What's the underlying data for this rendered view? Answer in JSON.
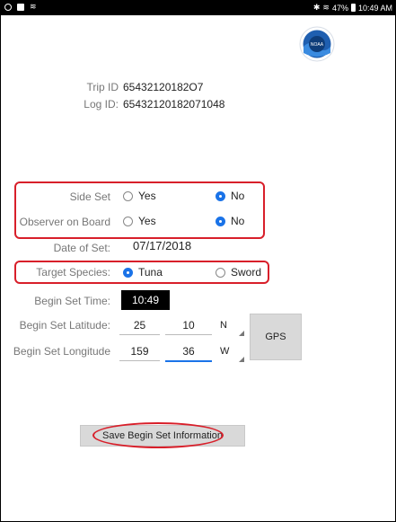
{
  "status_bar": {
    "time": "10:49 AM",
    "battery": "47%",
    "left_icons": [
      "settings-icon",
      "image-icon",
      "wifi-icon"
    ],
    "right_icons": [
      "bluetooth-icon",
      "signal-icon",
      "battery-icon"
    ]
  },
  "logo": {
    "text": "NOAA",
    "icon": "noaa-logo"
  },
  "trip": {
    "trip_id_label": "Trip ID",
    "trip_id_value": "65432120182O7",
    "log_id_label": "Log ID:",
    "log_id_value": "65432120182071048"
  },
  "side_set": {
    "label": "Side Set",
    "options": [
      "Yes",
      "No"
    ],
    "selected": "No"
  },
  "observer": {
    "label": "Observer on Board",
    "options": [
      "Yes",
      "No"
    ],
    "selected": "No"
  },
  "date_of_set": {
    "label": "Date of Set:",
    "value": "07/17/2018"
  },
  "target_species": {
    "label": "Target Species:",
    "options": [
      "Tuna",
      "Sword"
    ],
    "selected": "Tuna"
  },
  "begin_set_time": {
    "label": "Begin Set Time:",
    "value": "10:49"
  },
  "latitude": {
    "label": "Begin Set Latitude:",
    "degrees": "25",
    "minutes": "10",
    "direction": "N"
  },
  "longitude": {
    "label": "Begin Set Longitude",
    "degrees": "159",
    "minutes": "36",
    "direction": "W"
  },
  "buttons": {
    "gps_label": "GPS",
    "save_label": "Save Begin Set Information"
  },
  "colors": {
    "accent": "#1a73e8",
    "highlight": "#d81f2a",
    "label": "#777777"
  }
}
